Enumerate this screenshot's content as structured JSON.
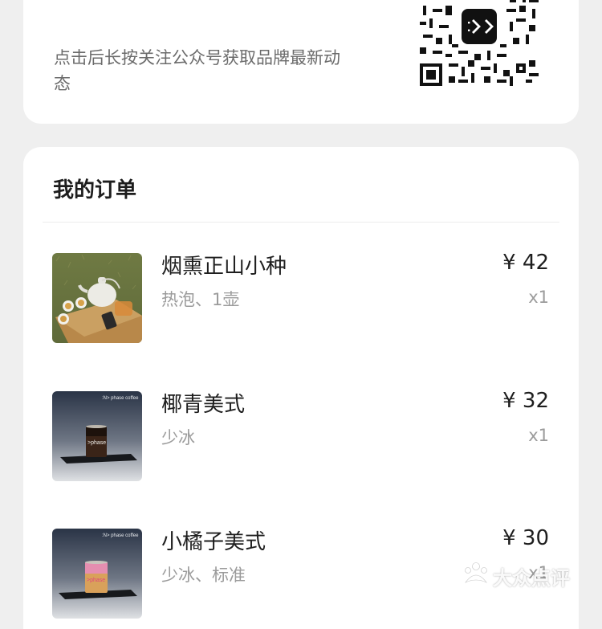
{
  "follow_card": {
    "text": "点击后长按关注公众号获取品牌最新动态",
    "qr_icon": "qr-code"
  },
  "orders": {
    "title": "我的订单",
    "items": [
      {
        "name": "烟熏正山小种",
        "spec": "热泡、1壶",
        "price": "¥ 42",
        "qty": "x1",
        "image": "tea-set-on-grass"
      },
      {
        "name": "椰青美式",
        "spec": "少冰",
        "price": "¥ 32",
        "qty": "x1",
        "image": "coffee-cup-on-tray"
      },
      {
        "name": "小橘子美式",
        "spec": "少冰、标准",
        "price": "¥ 30",
        "qty": "x1",
        "image": "coffee-cup-on-tray"
      }
    ]
  },
  "watermark": {
    "text": "大众点评"
  }
}
